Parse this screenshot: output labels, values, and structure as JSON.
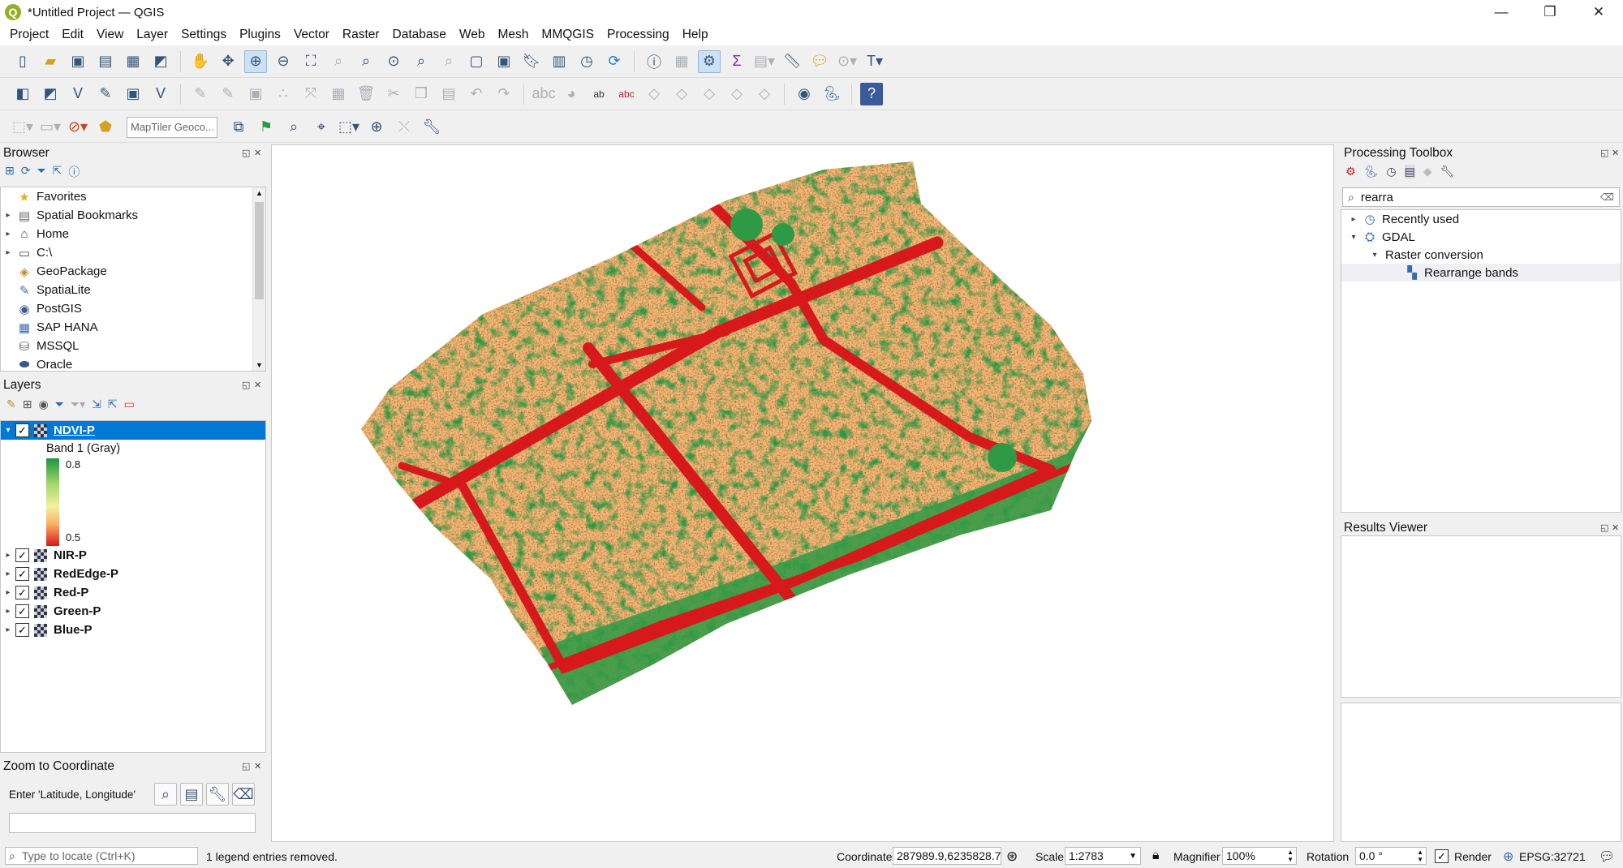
{
  "window": {
    "title": "*Untitled Project — QGIS",
    "logo_letter": "Q",
    "minimize": "—",
    "restore": "❐",
    "close": "✕"
  },
  "menu": [
    "Project",
    "Edit",
    "View",
    "Layer",
    "Settings",
    "Plugins",
    "Vector",
    "Raster",
    "Database",
    "Web",
    "Mesh",
    "MMQGIS",
    "Processing",
    "Help"
  ],
  "toolbar": {
    "geocoder_placeholder": "MapTiler Geoco..."
  },
  "browser": {
    "title": "Browser",
    "items": [
      {
        "label": "Favorites",
        "icon": "star-icon",
        "glyph": "★",
        "color": "#e0b020",
        "expandable": false
      },
      {
        "label": "Spatial Bookmarks",
        "icon": "bookmark-icon",
        "glyph": "▤",
        "color": "#666",
        "expandable": true
      },
      {
        "label": "Home",
        "icon": "home-icon",
        "glyph": "⌂",
        "color": "#444",
        "expandable": true
      },
      {
        "label": "C:\\",
        "icon": "folder-icon",
        "glyph": "▭",
        "color": "#444",
        "expandable": true
      },
      {
        "label": "GeoPackage",
        "icon": "geopackage-icon",
        "glyph": "◈",
        "color": "#c08a2a",
        "expandable": false
      },
      {
        "label": "SpatiaLite",
        "icon": "spatialite-icon",
        "glyph": "✎",
        "color": "#4a6a9a",
        "expandable": false
      },
      {
        "label": "PostGIS",
        "icon": "postgis-icon",
        "glyph": "◉",
        "color": "#3a5a8a",
        "expandable": false
      },
      {
        "label": "SAP HANA",
        "icon": "sap-hana-icon",
        "glyph": "▦",
        "color": "#3a6ab0",
        "expandable": false
      },
      {
        "label": "MSSQL",
        "icon": "mssql-icon",
        "glyph": "⛁",
        "color": "#555",
        "expandable": false
      },
      {
        "label": "Oracle",
        "icon": "oracle-icon",
        "glyph": "⬬",
        "color": "#3a5a8a",
        "expandable": false
      }
    ]
  },
  "layers": {
    "title": "Layers",
    "active": {
      "name": "NDVI-P",
      "band": "Band 1 (Gray)",
      "max_label": "0.8",
      "min_label": "0.5"
    },
    "others": [
      "NIR-P",
      "RedEdge-P",
      "Red-P",
      "Green-P",
      "Blue-P"
    ]
  },
  "zoom_coord": {
    "title": "Zoom to Coordinate",
    "prompt": "Enter 'Latitude, Longitude'"
  },
  "processing": {
    "title": "Processing Toolbox",
    "search_value": "rearra",
    "tree": [
      {
        "label": "Recently used",
        "level": 0,
        "arrow": "▸",
        "icon": "clock-icon",
        "glyph": "◷"
      },
      {
        "label": "GDAL",
        "level": 0,
        "arrow": "▾",
        "icon": "gdal-icon",
        "glyph": "⛭"
      },
      {
        "label": "Raster conversion",
        "level": 1,
        "arrow": "▾",
        "icon": "",
        "glyph": ""
      },
      {
        "label": "Rearrange bands",
        "level": 2,
        "arrow": "",
        "icon": "algorithm-icon",
        "glyph": "▚"
      }
    ]
  },
  "results": {
    "title": "Results Viewer"
  },
  "status": {
    "locator_placeholder": "Type to locate (Ctrl+K)",
    "message": "1 legend entries removed.",
    "coordinate_label": "Coordinate",
    "coordinate_value": "287989.9,6235828.7",
    "scale_label": "Scale",
    "scale_value": "1:2783",
    "magnifier_label": "Magnifier",
    "magnifier_value": "100%",
    "rotation_label": "Rotation",
    "rotation_value": "0.0 °",
    "render_label": "Render",
    "crs": "EPSG:32721"
  },
  "colors": {
    "ndvi_high": "#1a9641",
    "ndvi_mid": "#f3f0a0",
    "ndvi_low": "#d7191c",
    "selection": "#0078d7"
  }
}
